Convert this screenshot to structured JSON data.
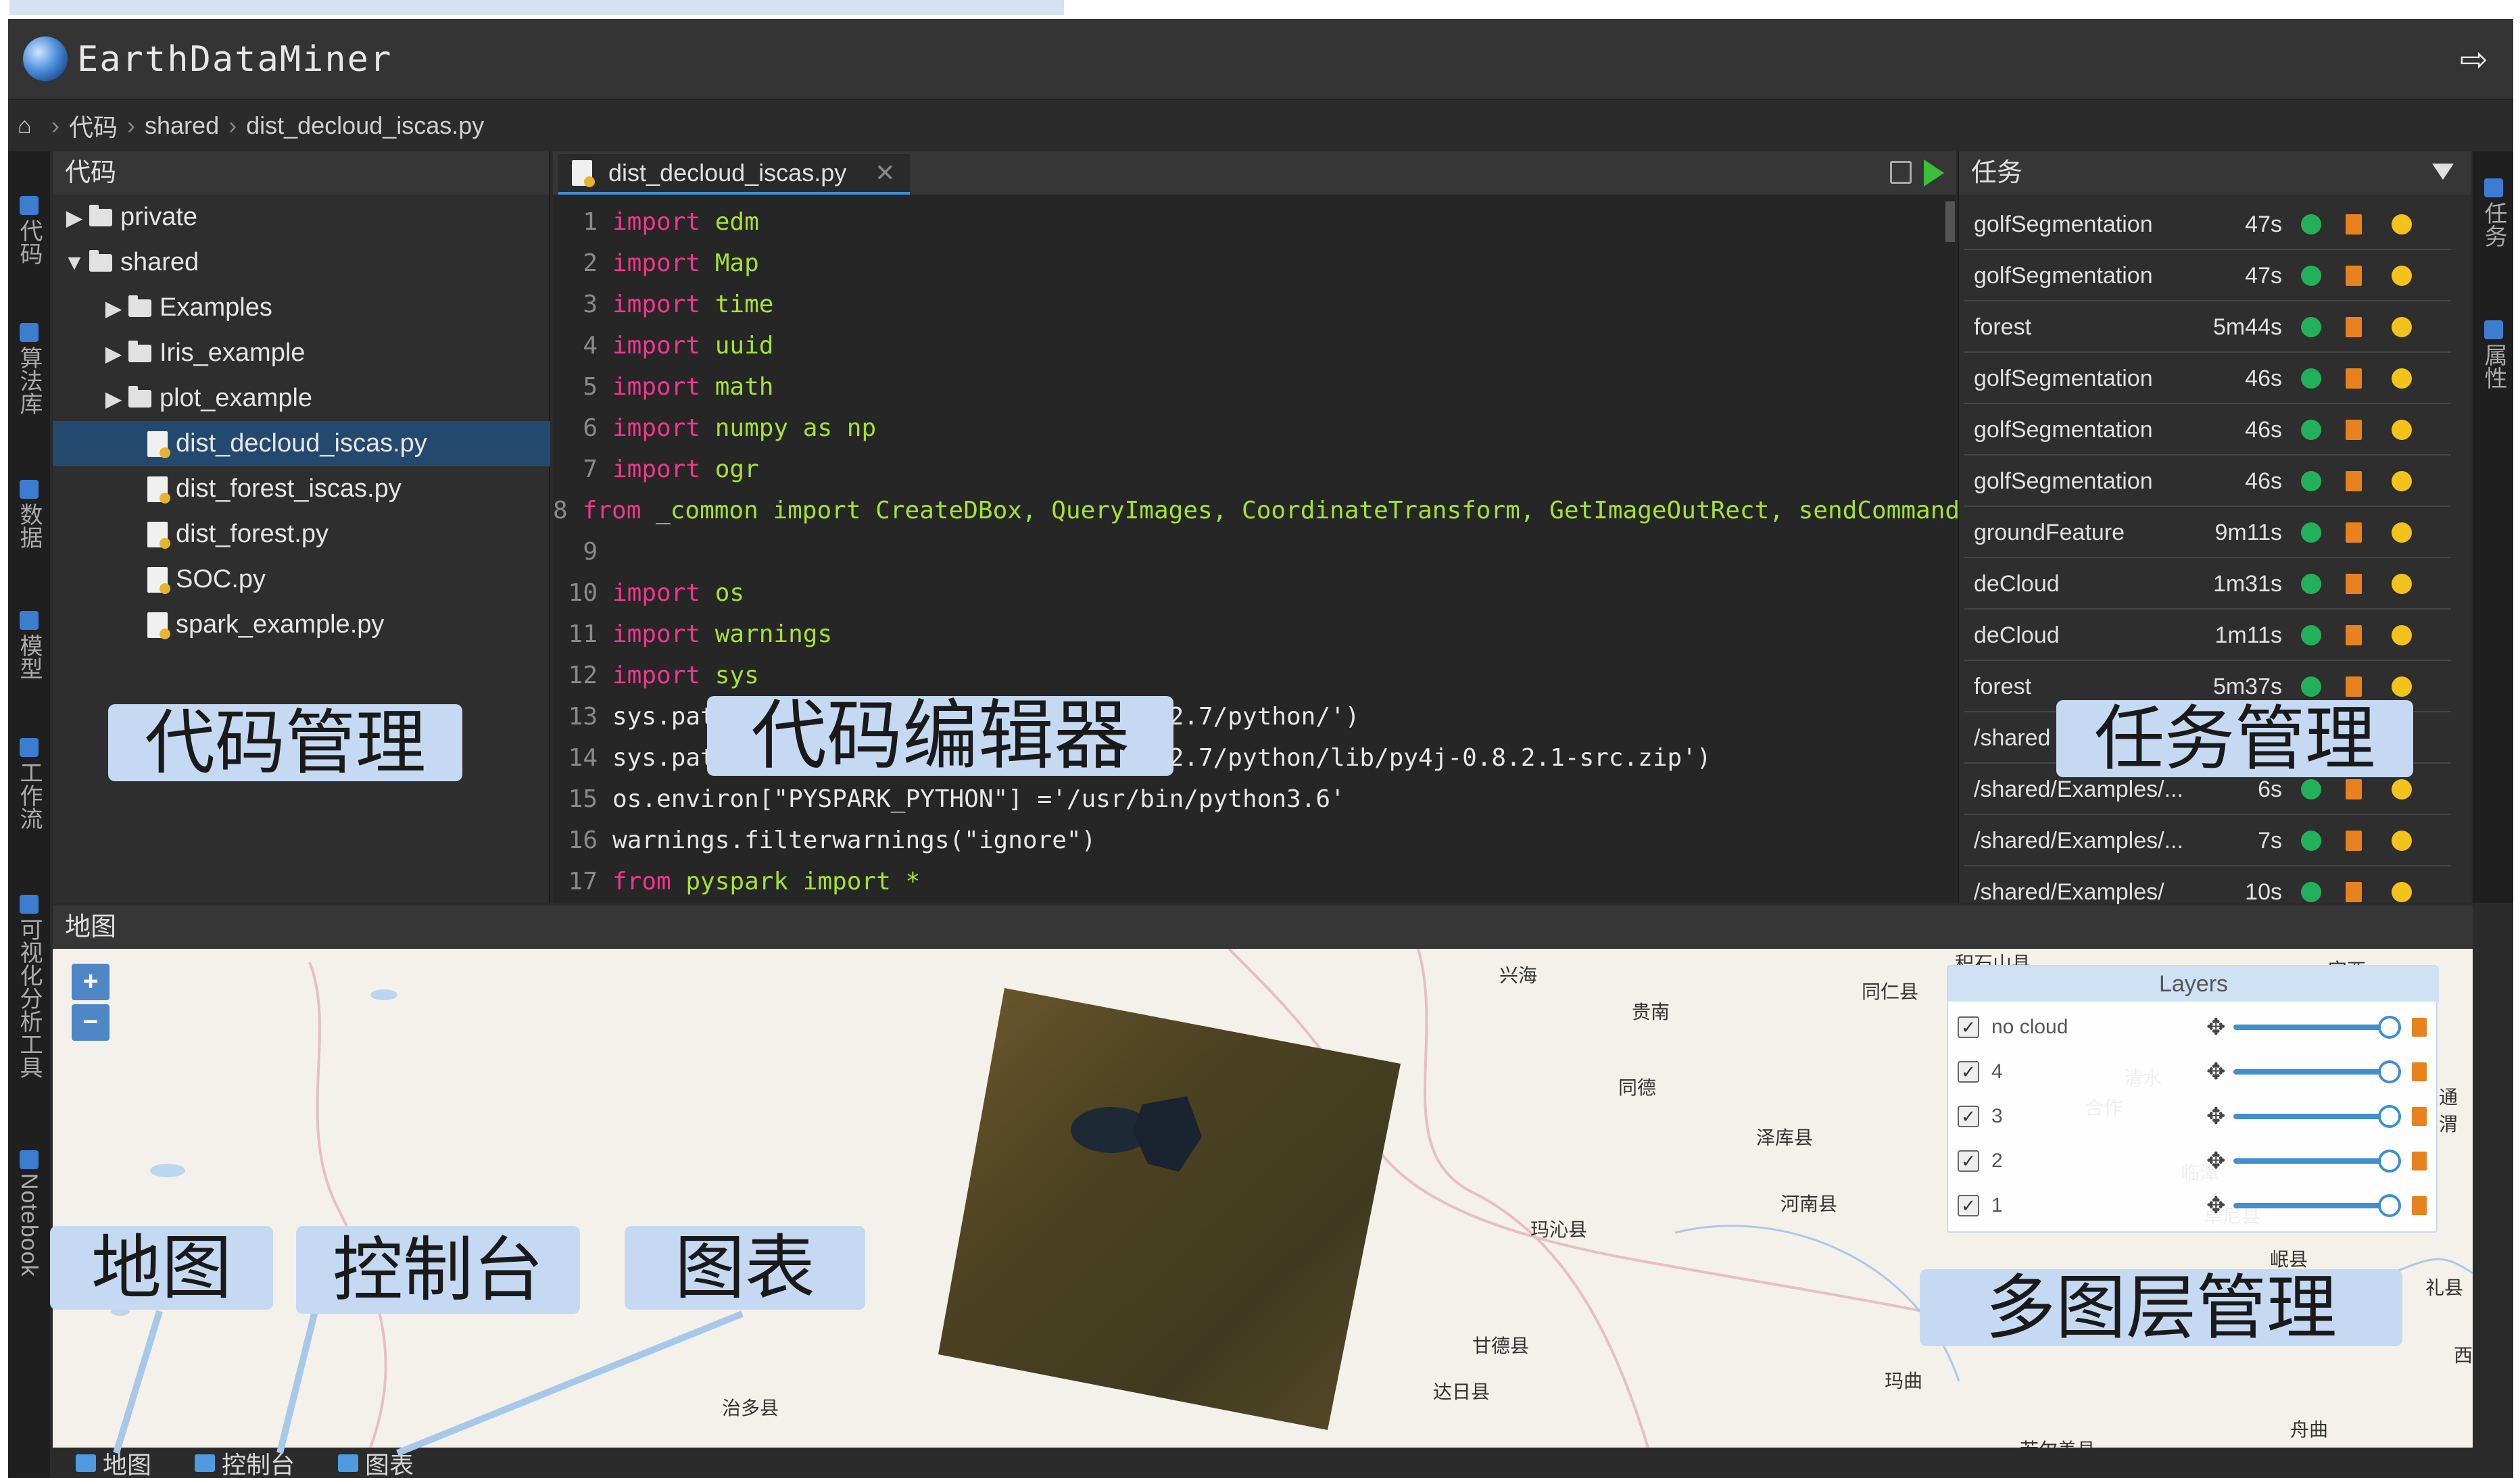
{
  "app": {
    "title": "EarthDataMiner"
  },
  "breadcrumb": {
    "items": [
      "代码",
      "shared",
      "dist_decloud_iscas.py"
    ]
  },
  "leftnav": [
    {
      "label": "代码"
    },
    {
      "label": "算法库"
    },
    {
      "label": "数据"
    },
    {
      "label": "模型"
    },
    {
      "label": "工作流"
    },
    {
      "label": "可视化分析工具"
    },
    {
      "label": "Notebook"
    }
  ],
  "rightnav": [
    {
      "label": "任务"
    },
    {
      "label": "属性"
    }
  ],
  "code_panel": {
    "title": "代码",
    "tree": [
      {
        "label": "private",
        "type": "folder",
        "expanded": false
      },
      {
        "label": "shared",
        "type": "folder",
        "expanded": true
      },
      {
        "label": "Examples",
        "type": "folder",
        "expanded": false
      },
      {
        "label": "Iris_example",
        "type": "folder",
        "expanded": false
      },
      {
        "label": "plot_example",
        "type": "folder",
        "expanded": false
      },
      {
        "label": "dist_decloud_iscas.py",
        "type": "file",
        "selected": true
      },
      {
        "label": "dist_forest_iscas.py",
        "type": "file"
      },
      {
        "label": "dist_forest.py",
        "type": "file"
      },
      {
        "label": "SOC.py",
        "type": "file"
      },
      {
        "label": "spark_example.py",
        "type": "file"
      }
    ]
  },
  "editor": {
    "tab_label": "dist_decloud_iscas.py",
    "lines": [
      {
        "n": "1",
        "kw": "import",
        "rest": " edm"
      },
      {
        "n": "2",
        "kw": "import",
        "rest": " Map"
      },
      {
        "n": "3",
        "kw": "import",
        "rest": " time"
      },
      {
        "n": "4",
        "kw": "import",
        "rest": " uuid"
      },
      {
        "n": "5",
        "kw": "import",
        "rest": " math"
      },
      {
        "n": "6",
        "kw": "import",
        "rest": " numpy as np"
      },
      {
        "n": "7",
        "kw": "import",
        "rest": " ogr"
      },
      {
        "n": "8",
        "kw": "from",
        "rest": " _common import CreateDBox, QueryImages, CoordinateTransform, GetImageOutRect, sendCommand"
      },
      {
        "n": "9",
        "kw": "",
        "rest": ""
      },
      {
        "n": "10",
        "kw": "import",
        "rest": " os"
      },
      {
        "n": "11",
        "kw": "import",
        "rest": " warnings"
      },
      {
        "n": "12",
        "kw": "import",
        "rest": " sys"
      },
      {
        "n": "13",
        "kw": "",
        "rest": "sys.pat                        -hadoop2.7/python/')"
      },
      {
        "n": "14",
        "kw": "",
        "rest": "sys.pat                        -hadoop2.7/python/lib/py4j-0.8.2.1-src.zip')"
      },
      {
        "n": "15",
        "kw": "",
        "rest": "os.environ[\"PYSPARK_PYTHON\"] ='/usr/bin/python3.6'"
      },
      {
        "n": "16",
        "kw": "",
        "rest": "warnings.filterwarnings(\"ignore\")"
      },
      {
        "n": "17",
        "kw": "from",
        "rest": " pyspark import *"
      }
    ]
  },
  "task_panel": {
    "title": "任务",
    "tasks": [
      {
        "name": "golfSegmentation",
        "time": "47s"
      },
      {
        "name": "golfSegmentation",
        "time": "47s"
      },
      {
        "name": "forest",
        "time": "5m44s"
      },
      {
        "name": "golfSegmentation",
        "time": "46s"
      },
      {
        "name": "golfSegmentation",
        "time": "46s"
      },
      {
        "name": "golfSegmentation",
        "time": "46s"
      },
      {
        "name": "groundFeature",
        "time": "9m11s"
      },
      {
        "name": "deCloud",
        "time": "1m31s"
      },
      {
        "name": "deCloud",
        "time": "1m11s"
      },
      {
        "name": "forest",
        "time": "5m37s"
      },
      {
        "name": "/shared",
        "time": ""
      },
      {
        "name": "/shared/Examples/...",
        "time": "6s"
      },
      {
        "name": "/shared/Examples/...",
        "time": "7s"
      },
      {
        "name": "/shared/Examples/",
        "time": "10s"
      }
    ]
  },
  "map_panel": {
    "title": "地图",
    "zoom_in": "+",
    "zoom_out": "−",
    "layers_title": "Layers",
    "layers": [
      {
        "name": "no cloud",
        "checked": true
      },
      {
        "name": "4",
        "checked": true
      },
      {
        "name": "3",
        "checked": true
      },
      {
        "name": "2",
        "checked": true
      },
      {
        "name": "1",
        "checked": true
      }
    ],
    "place_labels": [
      "兴海",
      "贵南",
      "同仁县",
      "同德",
      "泽库县",
      "河南县",
      "玛沁县",
      "甘德县",
      "达日县",
      "玛曲",
      "若尔盖县",
      "治多县",
      "积石山县",
      "定西",
      "清水",
      "合作",
      "临潭",
      "卓尼县",
      "岷县",
      "礼县",
      "通渭",
      "西",
      "舟曲"
    ]
  },
  "bottom_tabs": [
    {
      "label": "地图"
    },
    {
      "label": "控制台"
    },
    {
      "label": "图表"
    }
  ],
  "annotations": {
    "code_mgmt": "代码管理",
    "editor": "代码编辑器",
    "task_mgmt": "任务管理",
    "map": "地图",
    "console": "控制台",
    "chart": "图表",
    "layers_mgmt": "多图层管理"
  },
  "colors": {
    "accent": "#3f8fd2",
    "success": "#23b05a",
    "delete": "#e8821e",
    "info": "#f3c21b",
    "keyword": "#f0378a",
    "annotation_bg": "#c5daf2"
  }
}
